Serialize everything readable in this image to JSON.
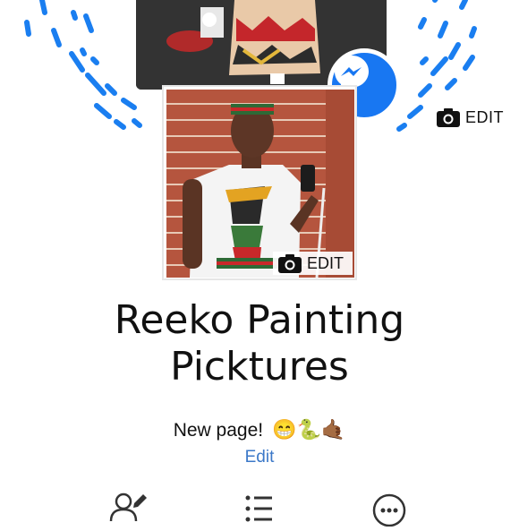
{
  "header": {
    "cover_edit_label": "EDIT",
    "cover_edit_icon": "camera-icon",
    "messenger_icon": "messenger-icon"
  },
  "profile": {
    "edit_label": "EDIT",
    "edit_icon": "camera-icon"
  },
  "page": {
    "title_line1": "Reeko Painting",
    "title_line2": "Picktures",
    "status_text": "New page!",
    "status_emojis": [
      "😁",
      "🐍",
      "🤙🏾"
    ],
    "edit_link": "Edit"
  },
  "actions": [
    {
      "icon": "edit-profile-icon"
    },
    {
      "icon": "list-icon"
    },
    {
      "icon": "more-icon"
    }
  ],
  "colors": {
    "messenger_blue": "#1877f2",
    "link_blue": "#3b78c8",
    "text": "#111111"
  }
}
